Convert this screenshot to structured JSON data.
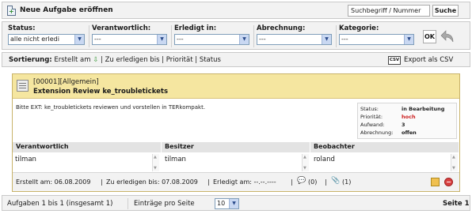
{
  "header": {
    "title": "Neue Aufgabe eröffnen",
    "search_value": "Suchbegriff / Nummer",
    "search_button": "Suche"
  },
  "filters": [
    {
      "label": "Status:",
      "value": "alle nicht erledi"
    },
    {
      "label": "Verantwortlich:",
      "value": "---"
    },
    {
      "label": "Erledigt in:",
      "value": "---"
    },
    {
      "label": "Abrechnung:",
      "value": "---"
    },
    {
      "label": "Kategorie:",
      "value": "---"
    }
  ],
  "ok_button": "OK",
  "sortbar": {
    "label": "Sortierung:",
    "created": "Erstellt am",
    "due": "Zu erledigen bis",
    "priority": "Priorität",
    "status": "Status",
    "csv_icon": "CSV",
    "export": "Export als CSV"
  },
  "task": {
    "id_category": "[00001][Allgemein]",
    "title": "Extension Review ke_troubletickets",
    "description": "Bitte EXT: ke_troubletickets reviewen und vorstellen in TERkompakt.",
    "status_box": [
      {
        "key": "Status:",
        "value": "in Bearbeitung"
      },
      {
        "key": "Priorität:",
        "value": "hoch"
      },
      {
        "key": "Aufwand:",
        "value": "3"
      },
      {
        "key": "Abrechnung:",
        "value": "offen"
      }
    ],
    "columns": [
      {
        "header": "Verantwortlich",
        "value": "tilman"
      },
      {
        "header": "Besitzer",
        "value": "tilman"
      },
      {
        "header": "Beobachter",
        "value": "roland"
      }
    ],
    "footer": {
      "created": "Erstellt am: 06.08.2009",
      "due": "Zu erledigen bis: 07.08.2009",
      "done": "Erledigt am: --.--.----",
      "comments": "(0)",
      "attachments": "(1)"
    }
  },
  "pager": {
    "summary": "Aufgaben 1 bis 1 (insgesamt 1)",
    "per_page_label": "Einträge pro Seite",
    "per_page_value": "10",
    "page": "Seite 1"
  },
  "colors": {
    "task_header_bg": "#f5e6a0",
    "priority_high": "#cc2020",
    "sort_arrow": "#3a9a3a"
  }
}
